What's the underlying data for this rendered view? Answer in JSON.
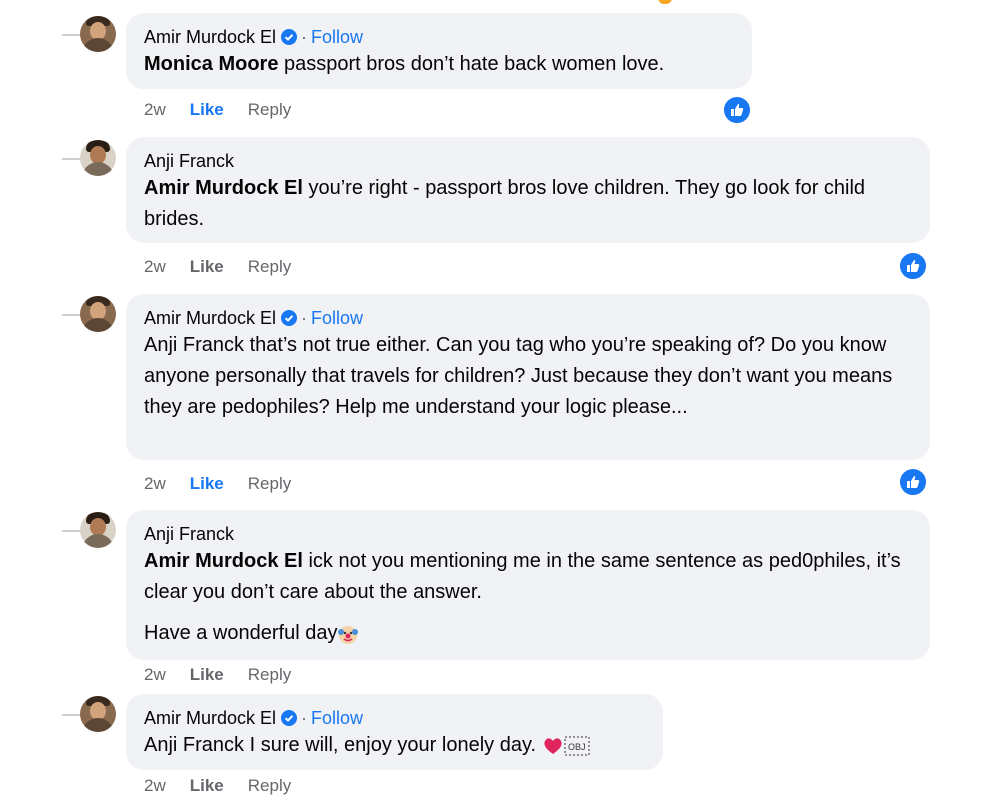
{
  "colors": {
    "accent": "#1877f2",
    "bubble": "#f0f2f5",
    "muted": "#65676b"
  },
  "comments": [
    {
      "author": "Amir Murdock El",
      "verified": true,
      "sep": "·",
      "follow": "Follow",
      "mention": "Monica Moore",
      "text": " passport bros don’t hate back women love.",
      "time": "2w",
      "like": "Like",
      "reply": "Reply",
      "liked": true
    },
    {
      "author": "Anji Franck",
      "verified": false,
      "mention": "Amir Murdock El",
      "text": " you’re right - passport bros love children. They go look for child brides.",
      "time": "2w",
      "like": "Like",
      "reply": "Reply",
      "liked": false
    },
    {
      "author": "Amir Murdock El",
      "verified": true,
      "sep": "·",
      "follow": "Follow",
      "text": "Anji Franck that’s not true either. Can you tag who you’re speaking of? Do you know anyone personally that travels for children? Just because they don’t want you means they are pedophiles? Help me understand your logic please...",
      "time": "2w",
      "like": "Like",
      "reply": "Reply",
      "liked": true
    },
    {
      "author": "Anji Franck",
      "verified": false,
      "mention": "Amir Murdock El",
      "text": " ick not you mentioning me in the same sentence as ped0philes, it’s clear you don’t care about the answer.",
      "text2": "Have a wonderful day",
      "time": "2w",
      "like": "Like",
      "reply": "Reply",
      "liked": false
    },
    {
      "author": "Amir Murdock El",
      "verified": true,
      "sep": "·",
      "follow": "Follow",
      "text": "Anji Franck I sure will, enjoy your lonely day.",
      "time": "2w",
      "like": "Like",
      "reply": "Reply",
      "liked": false
    }
  ],
  "icons": {
    "verified": "verified-badge-icon",
    "like_reaction": "like-reaction-icon",
    "clown": "clown-emoji-icon",
    "heart": "heart-emoji-icon",
    "obj": "object-replacement-icon"
  }
}
